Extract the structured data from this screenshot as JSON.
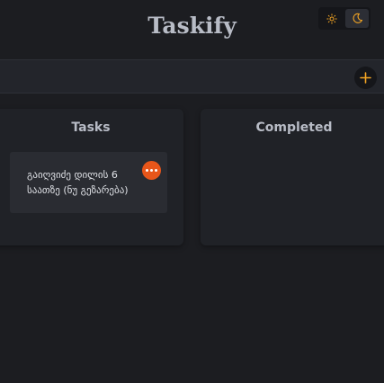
{
  "app": {
    "title": "Taskify"
  },
  "theme": {
    "light_icon": "sun-icon",
    "dark_icon": "moon-icon",
    "active": "dark",
    "accent": "#f5a623"
  },
  "input": {
    "value": "",
    "add_icon": "plus-icon"
  },
  "columns": {
    "tasks": {
      "title": "Tasks"
    },
    "completed": {
      "title": "Completed"
    }
  },
  "tasks": [
    {
      "text": "გაიღვიძე დილის 6 საათზე (ნუ გეზარება)",
      "menu_icon": "more-dots-icon",
      "menu_color": "#e8561a"
    }
  ]
}
